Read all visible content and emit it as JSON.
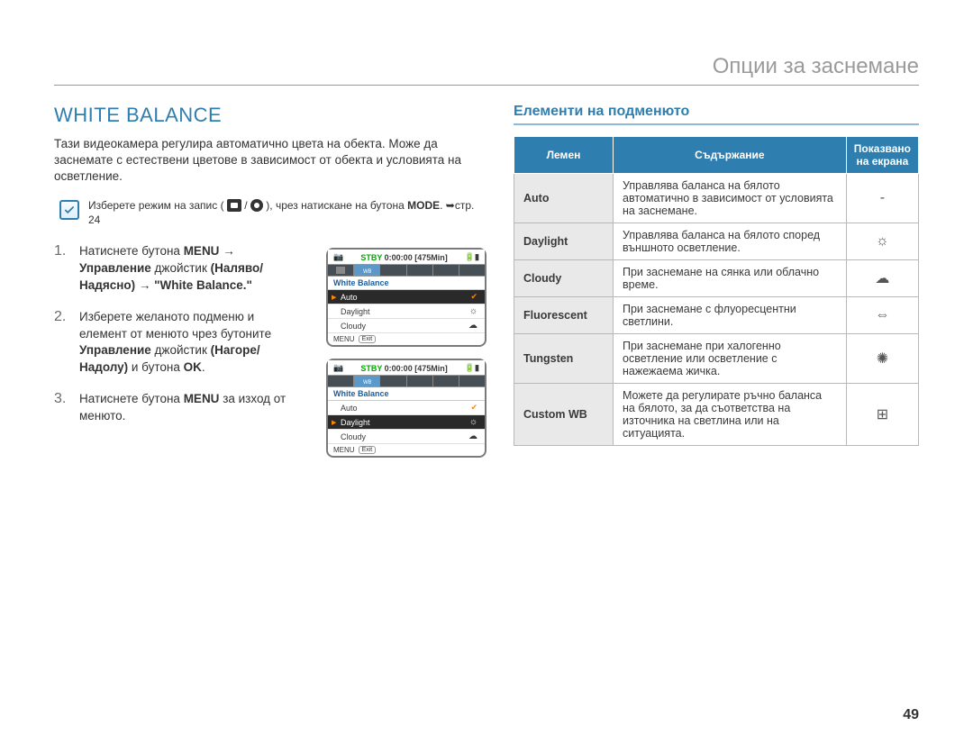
{
  "chapter_title": "Опции за заснемане",
  "section_title": "WHITE BALANCE",
  "intro": "Тази видеокамера регулира автоматично цвета на обекта. Може да заснемате с естествени цветове в зависимост от обекта и условията на осветление.",
  "note": {
    "prefix": "Изберете режим на запис ( ",
    "between": " / ",
    "suffix": " ), чрез натискане на бутона ",
    "mode_bold": "MODE",
    "page_ref": ". ➥стр. 24"
  },
  "steps": [
    {
      "num": "1.",
      "segments": [
        {
          "t": "Натиснете бутона "
        },
        {
          "t": "MENU",
          "b": true
        },
        {
          "t": " → "
        },
        {
          "t": "Управление",
          "b": true
        },
        {
          "t": " джойстик "
        },
        {
          "t": "(Наляво/Надясно)",
          "b": true
        },
        {
          "t": " → "
        },
        {
          "t": "\"White Balance.\"",
          "b": true
        }
      ]
    },
    {
      "num": "2.",
      "segments": [
        {
          "t": "Изберете желаното подменю и елемент от менюто чрез бутоните "
        },
        {
          "t": "Управление",
          "b": true
        },
        {
          "t": " джойстик "
        },
        {
          "t": "(Нагоре/Надолу)",
          "b": true
        },
        {
          "t": " и бутона "
        },
        {
          "t": "OK",
          "b": true
        },
        {
          "t": "."
        }
      ]
    },
    {
      "num": "3.",
      "segments": [
        {
          "t": "Натиснете бутона "
        },
        {
          "t": "MENU",
          "b": true
        },
        {
          "t": " за изход от менюто."
        }
      ]
    }
  ],
  "lcd": {
    "stby": "STBY",
    "time": "0:00:00",
    "remain": "[475Min]",
    "menu_title": "White Balance",
    "items": [
      "Auto",
      "Daylight",
      "Cloudy"
    ],
    "menu_label": "MENU",
    "exit_label": "Exit"
  },
  "submenu_title": "Елементи на подменюто",
  "table": {
    "headers": [
      "Лемен",
      "Съдържание",
      "Показвано на екрана"
    ],
    "rows": [
      {
        "name": "Auto",
        "desc": "Управлява баланса на бялото автоматично в зависимост от условията на заснемане.",
        "icon": "-"
      },
      {
        "name": "Daylight",
        "desc": "Управлява баланса на бялото според външното осветление.",
        "icon": "☼"
      },
      {
        "name": "Cloudy",
        "desc": "При заснемане на сянка или облачно време.",
        "icon": "☁"
      },
      {
        "name": "Fluorescent",
        "desc": "При заснемане с флуоресцентни светлини.",
        "icon": "⇔"
      },
      {
        "name": "Tungsten",
        "desc": "При заснемане при халогенно осветление или осветление с нажежаема жичка.",
        "icon": "✺"
      },
      {
        "name": "Custom WB",
        "desc": "Можете да регулирате ръчно баланса на бялото, за да съответства на източника на светлина или на ситуацията.",
        "icon": "⊞"
      }
    ]
  },
  "page_number": "49"
}
